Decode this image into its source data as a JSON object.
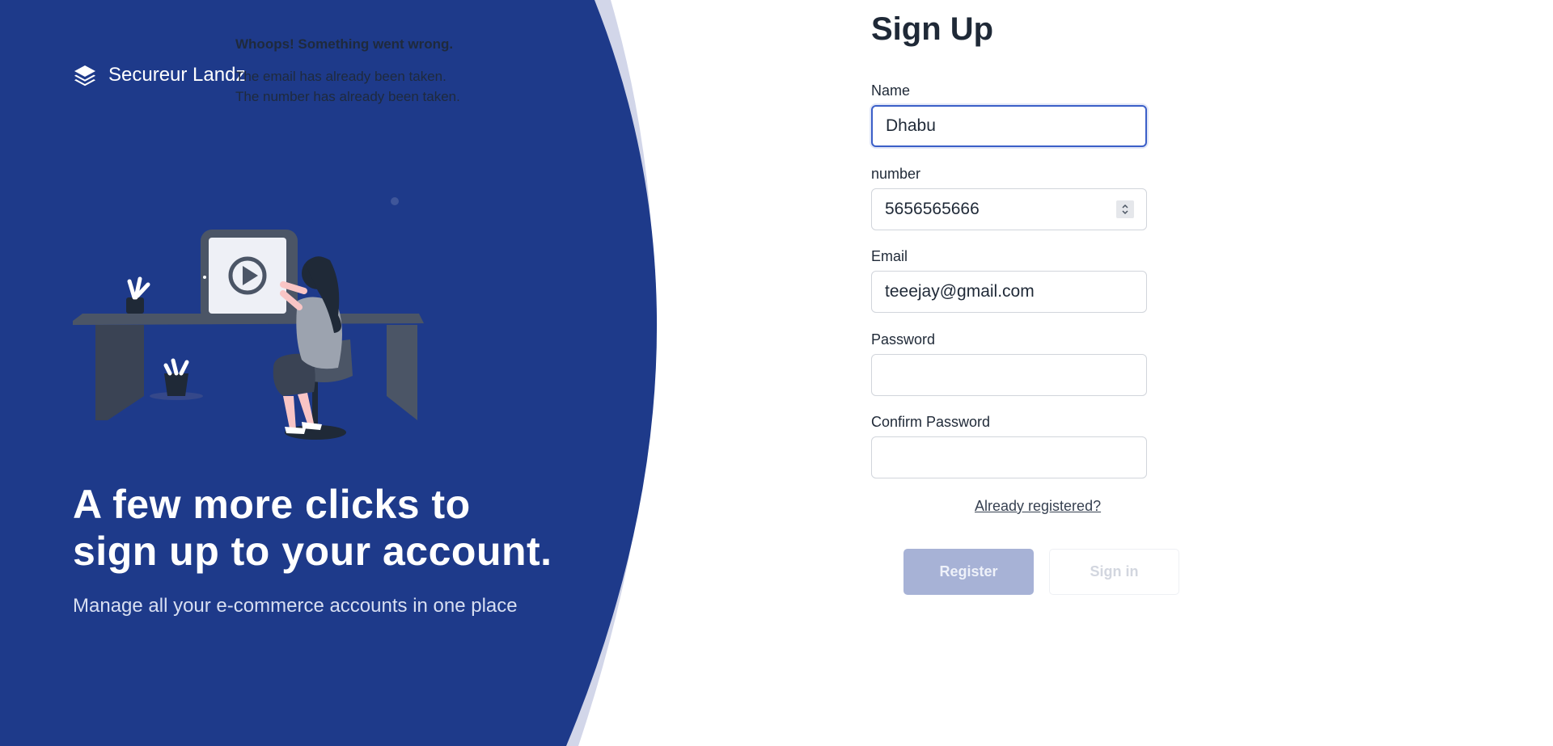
{
  "brand": {
    "name": "Secureur Landz",
    "icon": "layers-icon"
  },
  "errors": {
    "title": "Whoops! Something went wrong.",
    "items": [
      "The email has already been taken.",
      "The number has already been taken."
    ]
  },
  "hero": {
    "title_line1": "A few more clicks to",
    "title_line2": "sign up to your account.",
    "subtitle": "Manage all your e-commerce accounts in one place"
  },
  "form": {
    "title": "Sign Up",
    "name": {
      "label": "Name",
      "value": "Dhabu"
    },
    "number": {
      "label": "number",
      "value": "5656565666"
    },
    "email": {
      "label": "Email",
      "value": "teeejay@gmail.com"
    },
    "password": {
      "label": "Password",
      "value": ""
    },
    "confirm_password": {
      "label": "Confirm Password",
      "value": ""
    },
    "already_registered": "Already registered?",
    "register_label": "Register",
    "signin_label": "Sign in"
  },
  "colors": {
    "panel": "#1e3a8a",
    "panel_edge": "#d2d6e9",
    "accent": "#3b5fc8",
    "register_button": "#a7b2d6"
  }
}
